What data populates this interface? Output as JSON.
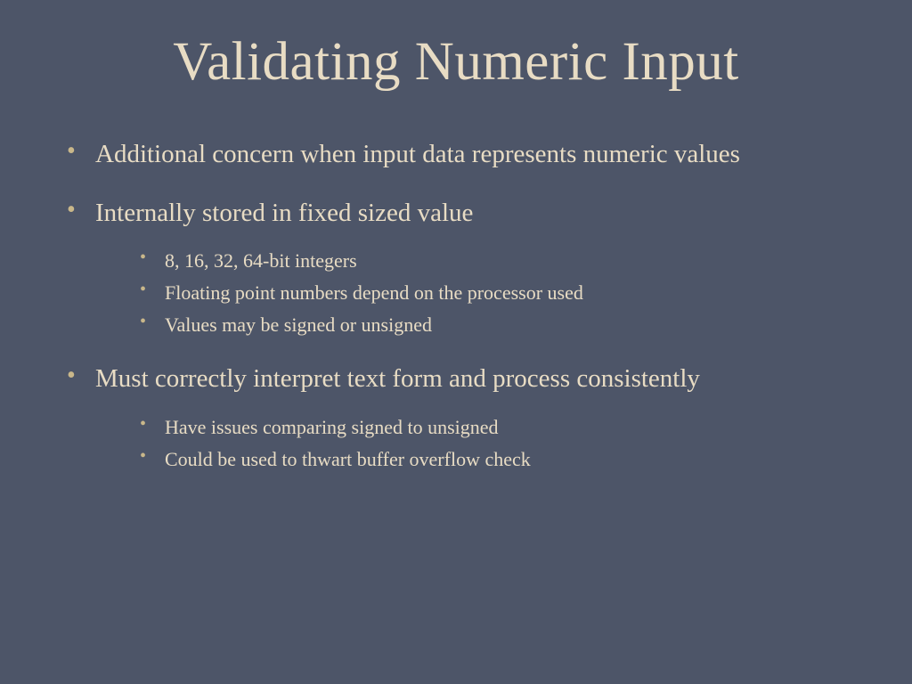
{
  "slide": {
    "title": "Validating Numeric Input",
    "bullets": [
      {
        "text": "Additional concern when input data represents numeric values",
        "sub": []
      },
      {
        "text": "Internally stored in fixed sized value",
        "sub": [
          "8, 16, 32, 64-bit integers",
          "Floating point numbers depend on the processor used",
          "Values may be signed or unsigned"
        ]
      },
      {
        "text": "Must correctly interpret text form and process consistently",
        "sub": [
          "Have issues comparing signed to unsigned",
          "Could be used to thwart buffer overflow check"
        ]
      }
    ]
  }
}
